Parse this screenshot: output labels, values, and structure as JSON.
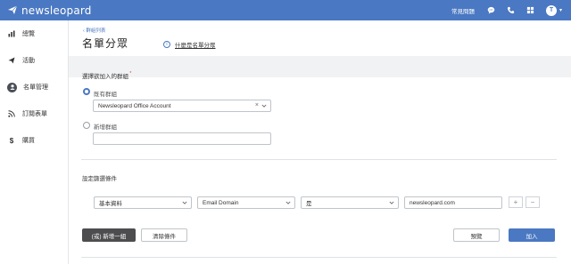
{
  "topbar": {
    "brand": "newsleopard",
    "faq": "常見問題",
    "avatar_initial": "T",
    "bg_color": "#4a78c2"
  },
  "sidebar": {
    "items": [
      {
        "label": "總覽",
        "icon": "bar-chart-icon"
      },
      {
        "label": "活動",
        "icon": "send-icon"
      },
      {
        "label": "名單管理",
        "icon": "user-icon",
        "active": true
      },
      {
        "label": "訂閱表單",
        "icon": "rss-icon"
      },
      {
        "label": "購買",
        "icon": "dollar-icon"
      }
    ]
  },
  "header": {
    "back_link": "群組列表",
    "title": "名單分眾",
    "help_link": "什麼是名單分眾"
  },
  "group": {
    "section_label": "選擇欲加入的群組",
    "existing_label": "既有群組",
    "existing_value": "Newsleopard Office Account",
    "new_label": "新增群組",
    "new_value": ""
  },
  "conditions": {
    "section_label": "設定篩選條件",
    "field_category": "基本資料",
    "field_name": "Email Domain",
    "operator": "是",
    "value": "newsleopard.com",
    "add_symbol": "+",
    "remove_symbol": "−"
  },
  "actions": {
    "or_add_group": "(或) 新增一組",
    "clear": "清除條件",
    "preview": "預覽",
    "submit": "加入"
  }
}
